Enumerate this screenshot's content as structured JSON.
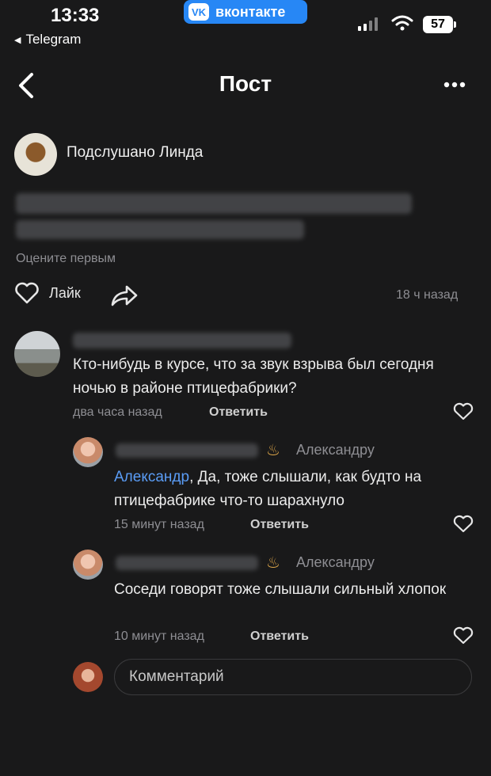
{
  "status_bar": {
    "time": "13:33",
    "back_app": "Telegram",
    "center_pill": "вконтакте",
    "battery": "57"
  },
  "header": {
    "title": "Пост"
  },
  "post": {
    "group_name": "Подслушано Линда",
    "rate_prompt": "Оцените первым",
    "like_label": "Лайк",
    "time_ago": "18 ч назад"
  },
  "comments": [
    {
      "text": "Кто-нибудь в курсе, что за звук взрыва был сегодня ночью в районе птицефабрики?",
      "time": "два часа назад",
      "reply_label": "Ответить"
    }
  ],
  "replies": [
    {
      "to_user": "Александру",
      "mention": "Александр",
      "text": ", Да, тоже слышали, как будто на птицефабрике что-то шарахнуло",
      "time": "15 минут назад",
      "reply_label": "Ответить"
    },
    {
      "to_user": "Александру",
      "text": "Соседи говорят тоже слышали сильный хлопок",
      "time": "10 минут назад",
      "reply_label": "Ответить"
    }
  ],
  "composer": {
    "placeholder": "Комментарий"
  },
  "colors": {
    "background": "#19191a",
    "accent": "#2787f5",
    "mention": "#5a9cf5"
  }
}
